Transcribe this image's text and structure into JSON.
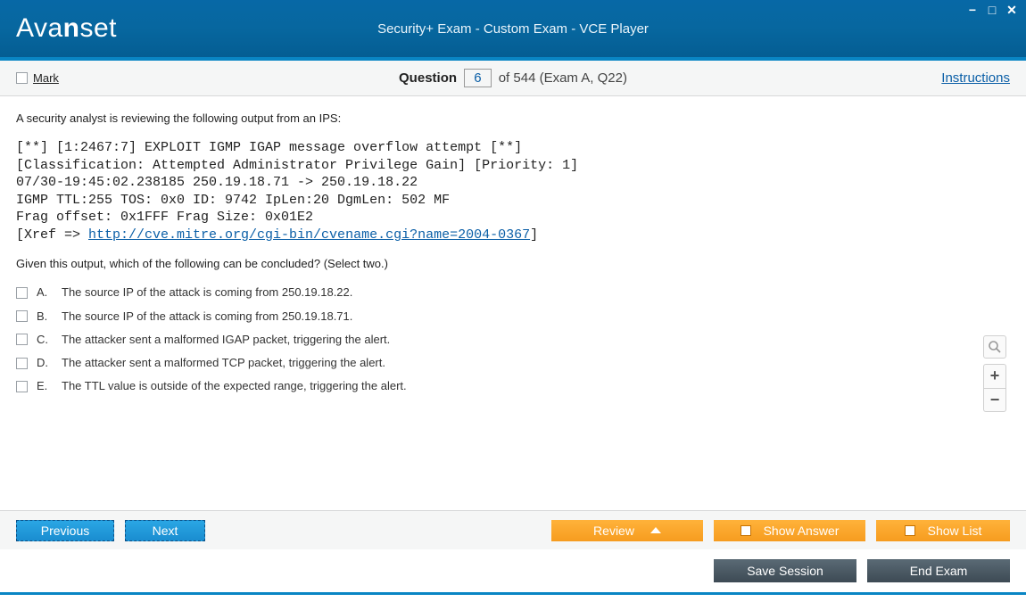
{
  "window": {
    "logo_a": "Ava",
    "logo_n": "n",
    "logo_set": "set",
    "title": "Security+ Exam - Custom Exam - VCE Player"
  },
  "toolbar": {
    "mark_label": "Mark",
    "question_word": "Question",
    "question_number": "6",
    "of_total": " of 544 (Exam A, Q22)",
    "instructions": "Instructions"
  },
  "question": {
    "intro": "A security analyst is reviewing the following output from an IPS:",
    "code_line1": "[**] [1:2467:7] EXPLOIT IGMP IGAP message overflow attempt [**]",
    "code_line2": "[Classification: Attempted Administrator Privilege Gain] [Priority: 1]",
    "code_line3": "07/30-19:45:02.238185 250.19.18.71 -> 250.19.18.22",
    "code_line4": "IGMP TTL:255 TOS: 0x0 ID: 9742 IpLen:20 DgmLen: 502 MF",
    "code_line5": "Frag offset: 0x1FFF Frag Size: 0x01E2",
    "code_line6_pre": "[Xref => ",
    "code_line6_link": "http://cve.mitre.org/cgi-bin/cvename.cgi?name=2004-0367",
    "code_line6_post": "]",
    "prompt": "Given this output, which of the following can be concluded? (Select two.)",
    "options": [
      {
        "letter": "A.",
        "text": "The source IP of the attack is coming from 250.19.18.22."
      },
      {
        "letter": "B.",
        "text": "The source IP of the attack is coming from 250.19.18.71."
      },
      {
        "letter": "C.",
        "text": "The attacker sent a malformed IGAP packet, triggering the alert."
      },
      {
        "letter": "D.",
        "text": "The attacker sent a malformed TCP packet, triggering the alert."
      },
      {
        "letter": "E.",
        "text": "The TTL value is outside of the expected range, triggering the alert."
      }
    ]
  },
  "buttons": {
    "previous": "Previous",
    "next": "Next",
    "review": "Review",
    "show_answer": "Show Answer",
    "show_list": "Show List",
    "save_session": "Save Session",
    "end_exam": "End Exam"
  }
}
